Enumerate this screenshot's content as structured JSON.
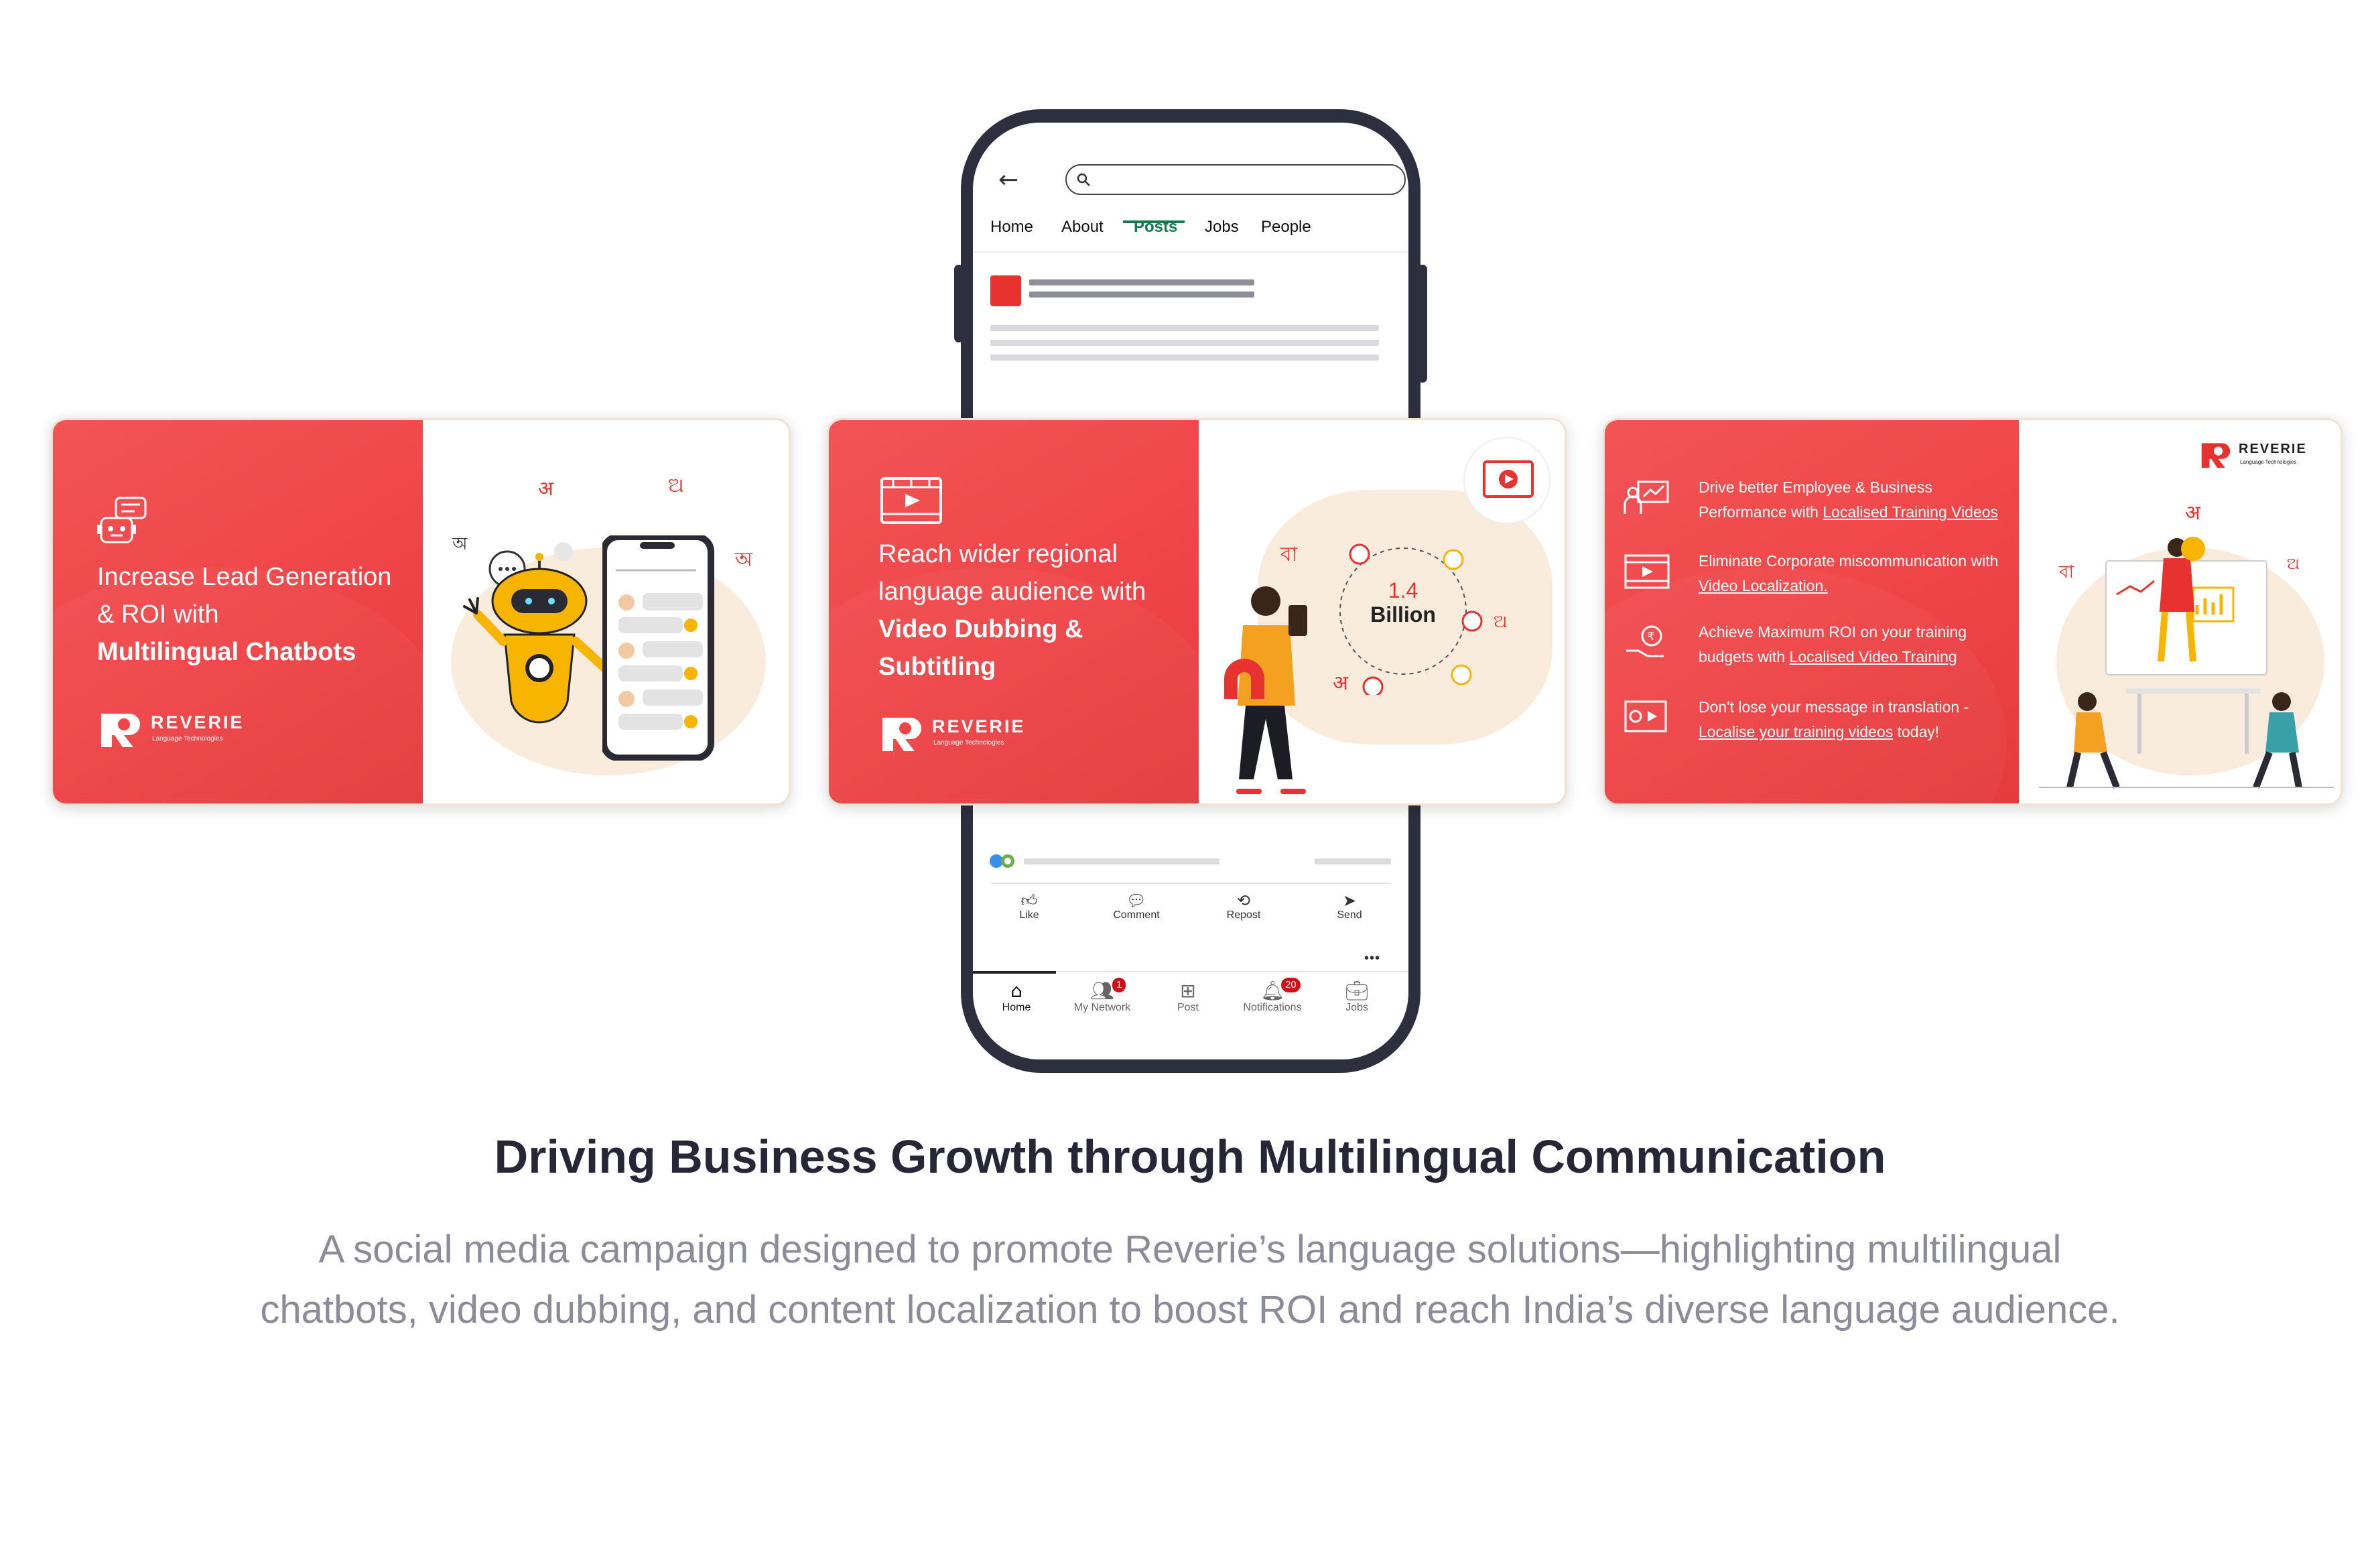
{
  "phone": {
    "tabs": [
      "Home",
      "About",
      "Posts",
      "Jobs",
      "People"
    ],
    "active_tab": "Posts",
    "actions": {
      "like": "Like",
      "comment": "Comment",
      "repost": "Repost",
      "send": "Send"
    },
    "nav": {
      "home": "Home",
      "network": "My Network",
      "network_badge": "1",
      "post": "Post",
      "notifications": "Notifications",
      "notifications_badge": "20",
      "jobs": "Jobs"
    }
  },
  "cards": {
    "chatbots": {
      "line1": "Increase Lead Generation",
      "line2": "& ROI with",
      "line3": "Multilingual Chatbots"
    },
    "dubbing": {
      "line1": "Reach wider regional",
      "line2": "language audience with",
      "line3": "Video Dubbing &",
      "line4": "Subtitling",
      "stat_value": "1.4",
      "stat_unit": "Billion"
    },
    "training": {
      "item1_a": "Drive better Employee & Business",
      "item1_b": "Performance with ",
      "item1_link": "Localised Training Videos",
      "item2_a": "Eliminate Corporate miscommunication with",
      "item2_link": "Video Localization.",
      "item3_a": "Achieve Maximum ROI on your training",
      "item3_b": "budgets with ",
      "item3_link": "Localised Video Training",
      "item4_a": "Don't lose your message in translation -",
      "item4_link": "Localise your training videos",
      "item4_c": " today!"
    }
  },
  "brand": {
    "name": "REVERIE",
    "tagline": "Language Technologies",
    "accent": "#ef4548",
    "green": "#137a4f"
  },
  "heading": "Driving Business Growth through Multilingual Communication",
  "description_line1": "A social media campaign designed to promote Reverie’s language solutions—highlighting multilingual",
  "description_line2": "chatbots, video dubbing, and content localization to boost ROI and reach India’s diverse language audience."
}
